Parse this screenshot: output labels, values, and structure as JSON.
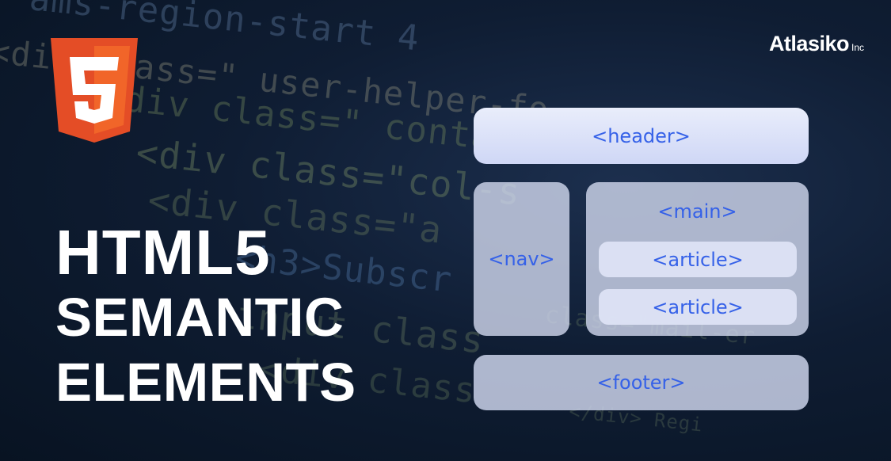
{
  "brand": {
    "name": "Atlasiko",
    "suffix": "Inc"
  },
  "headline": {
    "line1": "HTML5",
    "line2": "SEMANTIC",
    "line3": "ELEMENTS"
  },
  "diagram": {
    "header": "<header>",
    "nav": "<nav>",
    "main": "<main>",
    "article_1": "<article>",
    "article_2": "<article>",
    "footer": "<footer>"
  },
  "background_code": [
    "ams-region-start 4",
    "<div class=\" user-helper-fo",
    "div class=\" containe",
    "<div class=\"col-s",
    "<div class=\"a",
    "<h3>Subscr",
    "input class",
    "<div class",
    "class=\"mail-er",
    "</div> Regi"
  ],
  "colors": {
    "html5_logo": "#e44d26",
    "html5_logo_light": "#f16529",
    "box_text": "#3561e8"
  },
  "icons": {
    "logo": "html5-shield-icon"
  }
}
